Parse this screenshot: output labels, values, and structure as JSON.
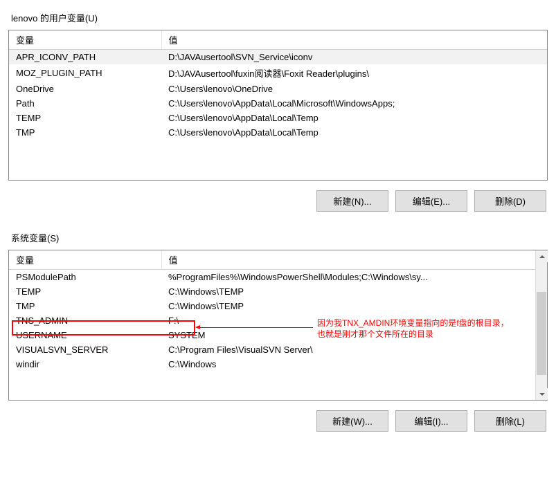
{
  "user_section": {
    "label": "lenovo 的用户变量(U)",
    "headers": {
      "var": "变量",
      "val": "值"
    },
    "rows": [
      {
        "var": "APR_ICONV_PATH",
        "val": "D:\\JAVAusertool\\SVN_Service\\iconv",
        "selected": true
      },
      {
        "var": "MOZ_PLUGIN_PATH",
        "val": "D:\\JAVAusertool\\fuxin阅读器\\Foxit Reader\\plugins\\"
      },
      {
        "var": "OneDrive",
        "val": "C:\\Users\\lenovo\\OneDrive"
      },
      {
        "var": "Path",
        "val": "C:\\Users\\lenovo\\AppData\\Local\\Microsoft\\WindowsApps;"
      },
      {
        "var": "TEMP",
        "val": "C:\\Users\\lenovo\\AppData\\Local\\Temp"
      },
      {
        "var": "TMP",
        "val": "C:\\Users\\lenovo\\AppData\\Local\\Temp"
      }
    ],
    "buttons": {
      "new": "新建(N)...",
      "edit": "编辑(E)...",
      "delete": "删除(D)"
    }
  },
  "system_section": {
    "label": "系统变量(S)",
    "headers": {
      "var": "变量",
      "val": "值"
    },
    "rows": [
      {
        "var": "PSModulePath",
        "val": "%ProgramFiles%\\WindowsPowerShell\\Modules;C:\\Windows\\sy..."
      },
      {
        "var": "TEMP",
        "val": "C:\\Windows\\TEMP"
      },
      {
        "var": "TMP",
        "val": "C:\\Windows\\TEMP"
      },
      {
        "var": "TNS_ADMIN",
        "val": "F:\\",
        "highlight": true
      },
      {
        "var": "USERNAME",
        "val": "SYSTEM"
      },
      {
        "var": "VISUALSVN_SERVER",
        "val": "C:\\Program Files\\VisualSVN Server\\"
      },
      {
        "var": "windir",
        "val": "C:\\Windows"
      }
    ],
    "buttons": {
      "new": "新建(W)...",
      "edit": "编辑(I)...",
      "delete": "删除(L)"
    }
  },
  "annotation": {
    "line1": "因为我TNX_AMDIN环境变量指向的是f盘的根目录，",
    "line2": "也就是刚才那个文件所在的目录"
  }
}
